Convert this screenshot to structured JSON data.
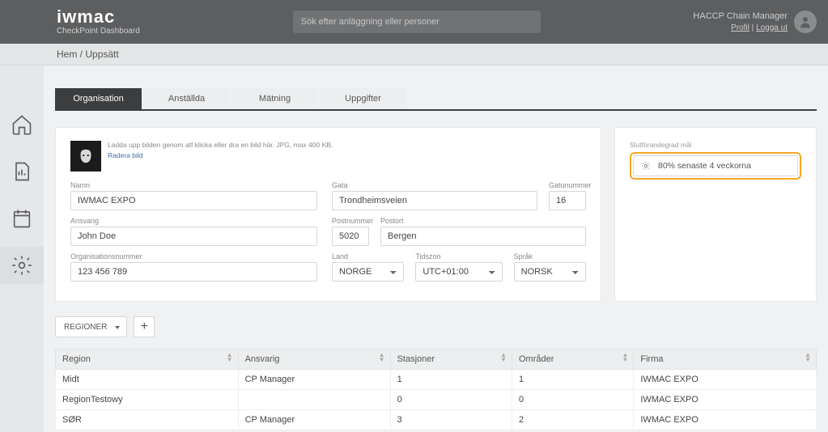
{
  "header": {
    "brand": "iwmac",
    "brand_sub": "CheckPoint Dashboard",
    "search_placeholder": "Sök efter anläggning eller personer",
    "app_name": "HACCP Chain Manager",
    "profile_link": "Profil",
    "logout_link": "Logga ut"
  },
  "breadcrumb": {
    "hem": "Hem",
    "current": "Uppsätt"
  },
  "tabs": [
    {
      "label": "Organisation"
    },
    {
      "label": "Anställda"
    },
    {
      "label": "Mätning"
    },
    {
      "label": "Uppgifter"
    }
  ],
  "org_panel": {
    "upload_hint": "Ladda upp bilden genom att klicka eller dra en bild här. JPG, max 400 KB.",
    "delete_image": "Radera bild",
    "labels": {
      "namn": "Namn",
      "ansvarig": "Ansvarig",
      "orgnr": "Organisationsnummer",
      "gata": "Gata",
      "gatunummer": "Gatunummer",
      "postnummer": "Postnummer",
      "postort": "Postort",
      "land": "Land",
      "tidszon": "Tidszon",
      "sprak": "Språk"
    },
    "values": {
      "namn": "IWMAC EXPO",
      "ansvarig": "John Doe",
      "orgnr": "123 456 789",
      "gata": "Trondheimsveien",
      "gatunummer": "16",
      "postnummer": "5020",
      "postort": "Bergen",
      "land": "NORGE",
      "tidszon": "UTC+01:00",
      "sprak": "NORSK"
    }
  },
  "goal": {
    "label": "Slutförandegrad mål",
    "text": "80% senaste 4 veckorna"
  },
  "table_controls": {
    "regions_btn": "REGIONER"
  },
  "table": {
    "headers": {
      "region": "Region",
      "ansvarig": "Ansvarig",
      "stasjoner": "Stasjoner",
      "omrader": "Områder",
      "firma": "Firma"
    },
    "rows": [
      {
        "region": "Midt",
        "ansvarig": "CP Manager",
        "stasjoner": "1",
        "omrader": "1",
        "firma": "IWMAC EXPO"
      },
      {
        "region": "RegionTestowy",
        "ansvarig": "",
        "stasjoner": "0",
        "omrader": "0",
        "firma": "IWMAC EXPO"
      },
      {
        "region": "SØR",
        "ansvarig": "CP Manager",
        "stasjoner": "3",
        "omrader": "2",
        "firma": "IWMAC EXPO"
      }
    ]
  }
}
